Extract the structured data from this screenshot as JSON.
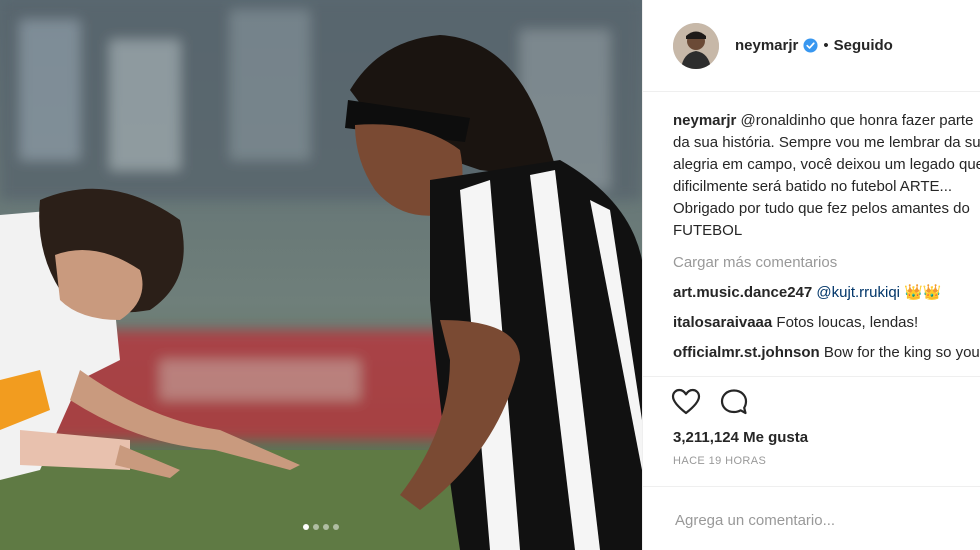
{
  "post": {
    "username": "neymarjr",
    "separator": "•",
    "follow_status": "Seguido",
    "caption_user": "neymarjr",
    "caption_text": "@ronaldinho que honra fazer parte da sua história. Sempre vou me lembrar da sua alegria em campo, você deixou um legado que dificilmente será batido no futebol ARTE... Obrigado por tudo que fez pelos amantes do FUTEBOL",
    "load_more": "Cargar más comentarios",
    "comments": [
      {
        "user": "art.music.dance247",
        "mention": "@kujt.rrukiqi",
        "text": "",
        "emoji": "👑👑"
      },
      {
        "user": "italosaraivaaa",
        "mention": "",
        "text": "Fotos loucas, lendas!",
        "emoji": ""
      },
      {
        "user": "officialmr.st.johnson",
        "mention": "",
        "text": "Bow for the king so you can become one😁😁😁",
        "emoji": ""
      }
    ],
    "likes": "3,211,124 Me gusta",
    "time": "HACE 19 HORAS",
    "add_comment_placeholder": "Agrega un comentario...",
    "carousel": {
      "count": 4,
      "active": 0
    }
  },
  "icons": {
    "like": "heart-icon",
    "comment": "comment-icon",
    "verified": "verified-badge-icon"
  },
  "colors": {
    "verified": "#3897f0",
    "border": "#efefef",
    "muted": "#999999",
    "text": "#262626"
  }
}
